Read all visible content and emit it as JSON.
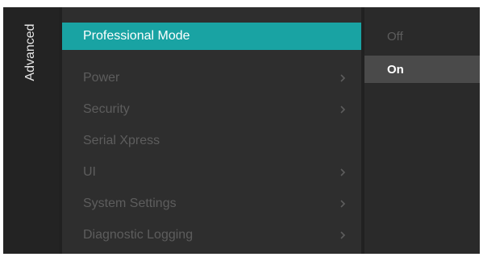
{
  "side_panel": {
    "label": "Advanced"
  },
  "menu": {
    "selected_index": 0,
    "items": [
      {
        "label": "Professional Mode",
        "has_submenu": false
      },
      {
        "label": "Power",
        "has_submenu": true
      },
      {
        "label": "Security",
        "has_submenu": true
      },
      {
        "label": "Serial Xpress",
        "has_submenu": false
      },
      {
        "label": "UI",
        "has_submenu": true
      },
      {
        "label": "System Settings",
        "has_submenu": true
      },
      {
        "label": "Diagnostic Logging",
        "has_submenu": true
      }
    ]
  },
  "options": {
    "selected_index": 1,
    "items": [
      {
        "label": "Off"
      },
      {
        "label": "On"
      }
    ]
  },
  "colors": {
    "accent": "#19a3a3",
    "background": "#212121",
    "menu_background": "#2e2e2e",
    "dim_text": "#5d5d5d",
    "selected_option": "#4a4a4a"
  }
}
